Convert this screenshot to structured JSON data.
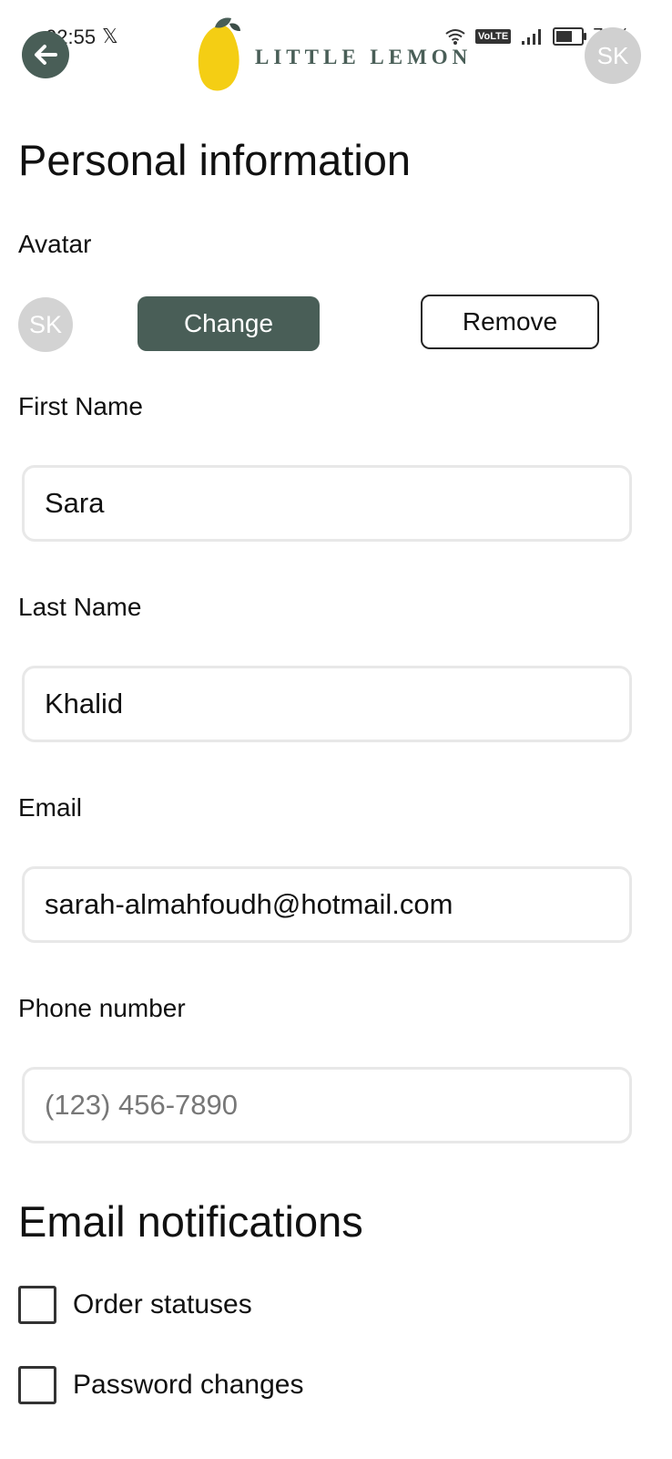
{
  "status_bar": {
    "time": "02:55",
    "x_glyph": "𝕏",
    "volte": "VoLTE",
    "battery": "76%",
    "battery_level": 0.76
  },
  "header": {
    "back_icon": "arrow-left-icon",
    "logo_text": "LITTLE LEMON",
    "avatar_initials": "SK",
    "brand_color": "#495e57",
    "lemon_color": "#f4ce14"
  },
  "personal": {
    "title": "Personal information",
    "avatar_label": "Avatar",
    "avatar_initials": "SK",
    "change_label": "Change",
    "remove_label": "Remove",
    "first_name_label": "First Name",
    "first_name_value": "Sara",
    "last_name_label": "Last Name",
    "last_name_value": "Khalid",
    "email_label": "Email",
    "email_value": "sarah-almahfoudh@hotmail.com",
    "phone_label": "Phone number",
    "phone_placeholder": "(123) 456-7890"
  },
  "notifications": {
    "title": "Email notifications",
    "items": [
      {
        "label": "Order statuses",
        "checked": false
      },
      {
        "label": "Password changes",
        "checked": false
      }
    ]
  }
}
